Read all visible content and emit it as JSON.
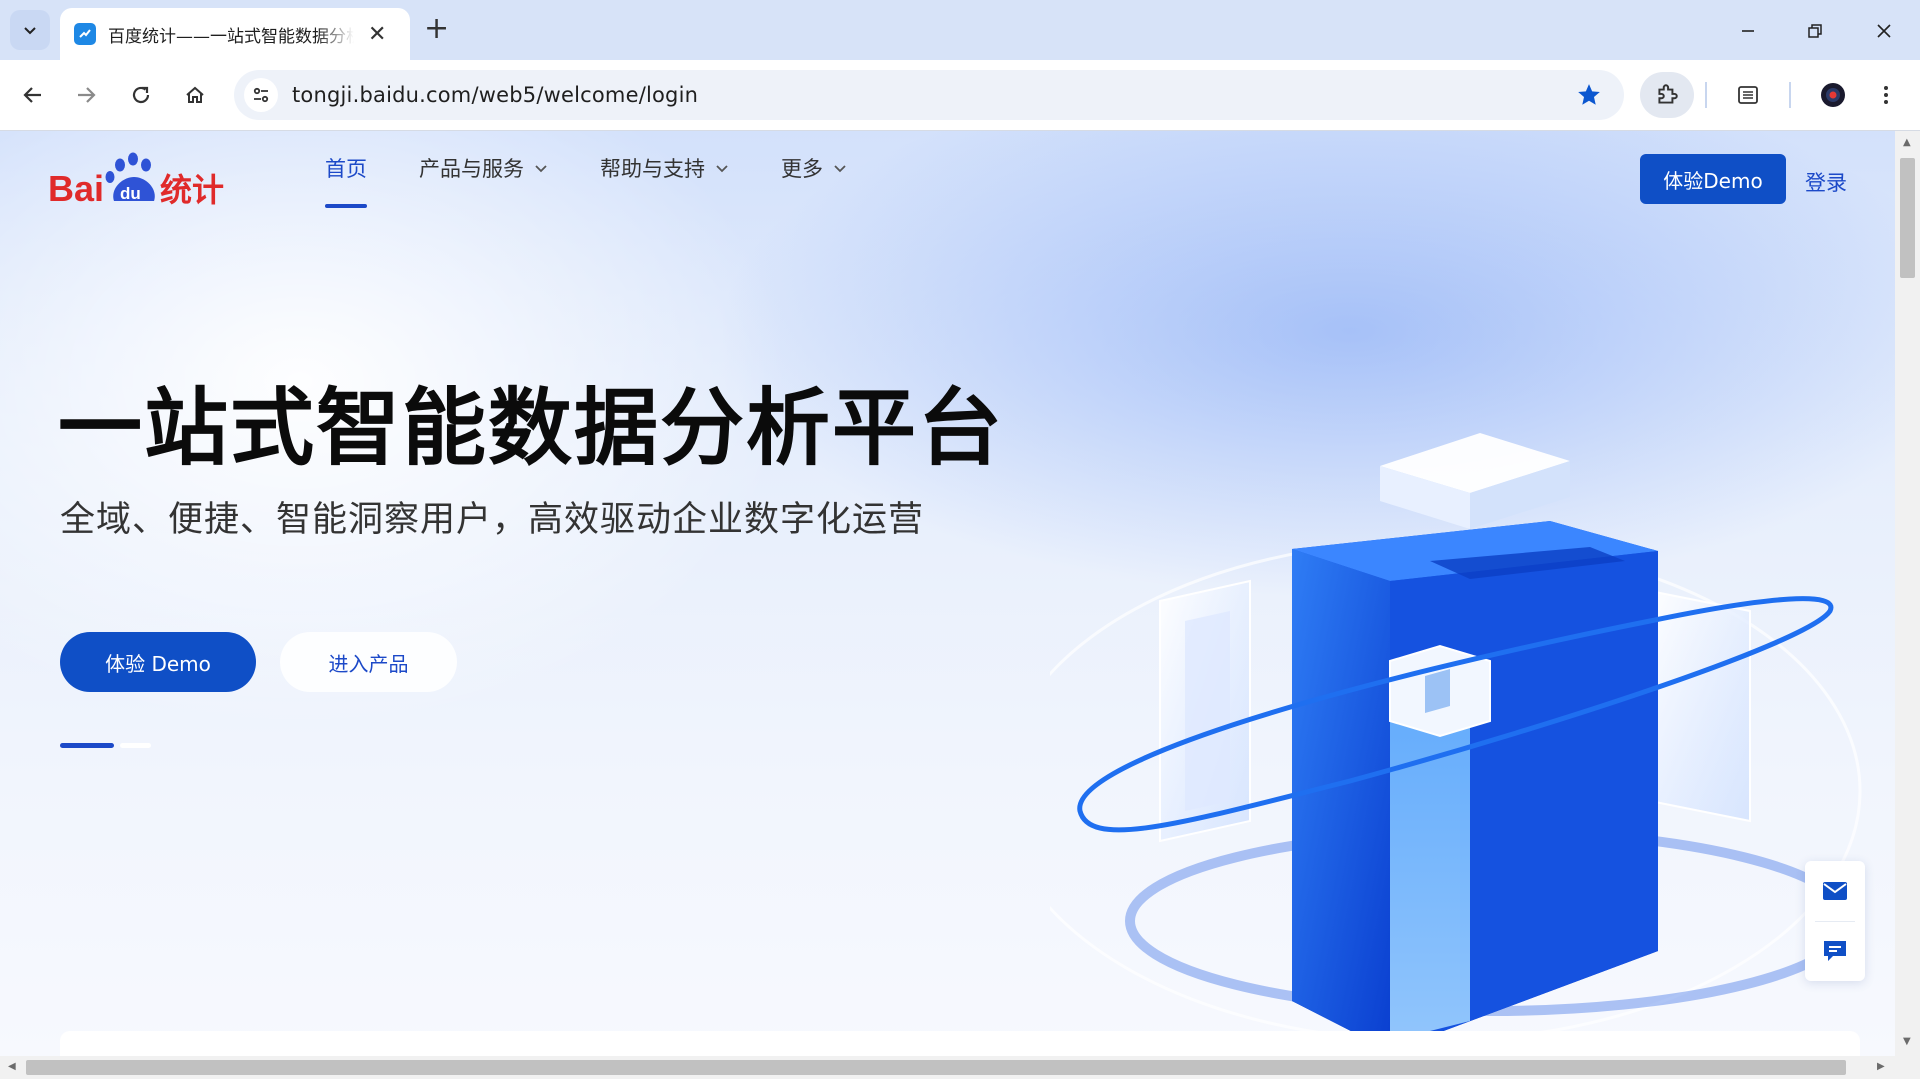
{
  "browser": {
    "tab_title": "百度统计——一站式智能数据分析平台",
    "url": "tongji.baidu.com/web5/welcome/login",
    "tab_close_glyph": "✕",
    "new_tab_glyph": "+"
  },
  "header": {
    "logo_text_bai": "Bai",
    "logo_text_du": "du",
    "logo_text_product": "统计",
    "nav": [
      {
        "label": "首页",
        "active": true,
        "has_dropdown": false
      },
      {
        "label": "产品与服务",
        "active": false,
        "has_dropdown": true
      },
      {
        "label": "帮助与支持",
        "active": false,
        "has_dropdown": true
      },
      {
        "label": "更多",
        "active": false,
        "has_dropdown": true
      }
    ],
    "demo_button": "体验Demo",
    "login_link": "登录"
  },
  "hero": {
    "title": "一站式智能数据分析平台",
    "subtitle": "全域、便捷、智能洞察用户，高效驱动企业数字化运营",
    "primary_button": "体验 Demo",
    "secondary_button": "进入产品",
    "carousel_active_index": 0,
    "carousel_count": 2
  },
  "colors": {
    "brand_blue": "#0f4fc6",
    "link_blue": "#1c49c8",
    "logo_red": "#e02a2a"
  },
  "icons": [
    "search-tabs-icon",
    "favicon-icon",
    "back-icon",
    "forward-icon",
    "reload-icon",
    "home-icon",
    "site-info-icon",
    "bookmark-star-icon",
    "extensions-icon",
    "reading-list-icon",
    "profile-icon",
    "menu-icon",
    "mail-icon",
    "chat-icon"
  ]
}
